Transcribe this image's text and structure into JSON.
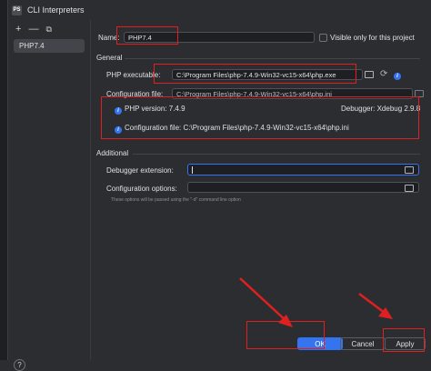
{
  "window": {
    "title": "CLI Interpreters",
    "app_icon": "PS"
  },
  "sidebar": {
    "toolbar": {
      "add": "+",
      "remove": "—",
      "copy": "⧉"
    },
    "items": [
      {
        "label": "PHP7.4"
      }
    ]
  },
  "form": {
    "name_label": "Name:",
    "name_value": "PHP7.4",
    "visible_only_label": "Visible only for this project",
    "general_section": "General",
    "php_executable_label": "PHP executable:",
    "php_executable_value": "C:\\Program Files\\php-7.4.9-Win32-vc15-x64\\php.exe",
    "configuration_file_label": "Configuration file:",
    "configuration_file_value": "C:\\Program Files\\php-7.4.9-Win32-vc15-x64\\php.ini",
    "php_version_text": "PHP version: 7.4.9",
    "debugger_text": "Debugger: Xdebug 2.9.8",
    "info_config_text": "Configuration file: C:\\Program Files\\php-7.4.9-Win32-vc15-x64\\php.ini",
    "additional_section": "Additional",
    "debugger_extension_label": "Debugger extension:",
    "debugger_extension_value": "",
    "configuration_options_label": "Configuration options:",
    "configuration_options_value": "",
    "hint_text": "These options will be passed using the \"-d\" command line option"
  },
  "footer": {
    "ok_label": "OK",
    "cancel_label": "Cancel",
    "apply_label": "Apply",
    "help_label": "?"
  },
  "colors": {
    "accent": "#3574f0",
    "annotation_red": "#e02020",
    "background": "#2b2d30"
  }
}
